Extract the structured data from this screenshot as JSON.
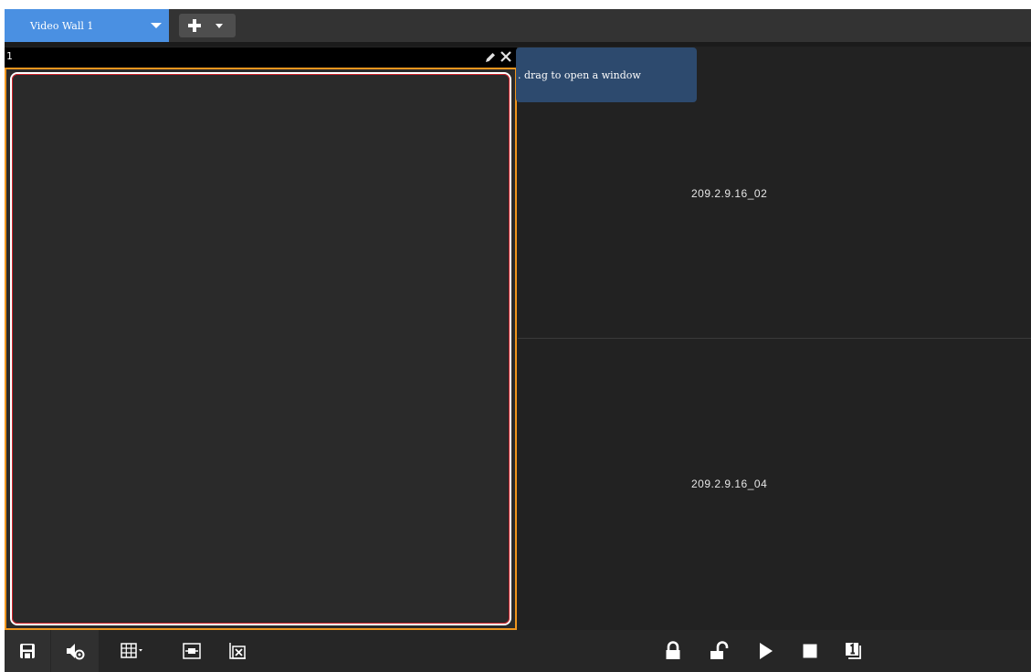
{
  "tabs": {
    "active_label": "Video Wall 1"
  },
  "screens": {
    "left_number": "1",
    "right_top_label": "209.2.9.16_02",
    "right_bottom_label": "209.2.9.16_04"
  },
  "tooltip": {
    "text": ". drag to open a window"
  },
  "colors": {
    "active_tab": "#4a90e2",
    "selected_border": "#f0961e",
    "inner_border": "#d0222a",
    "tooltip_bg": "#2d4a6e"
  },
  "toolbar_icons": [
    "save-icon",
    "audio-settings-icon",
    "layout-grid-icon",
    "fit-window-icon",
    "close-all-icon",
    "lock-icon",
    "unlock-icon",
    "play-icon",
    "stop-icon",
    "window-number-icon"
  ]
}
